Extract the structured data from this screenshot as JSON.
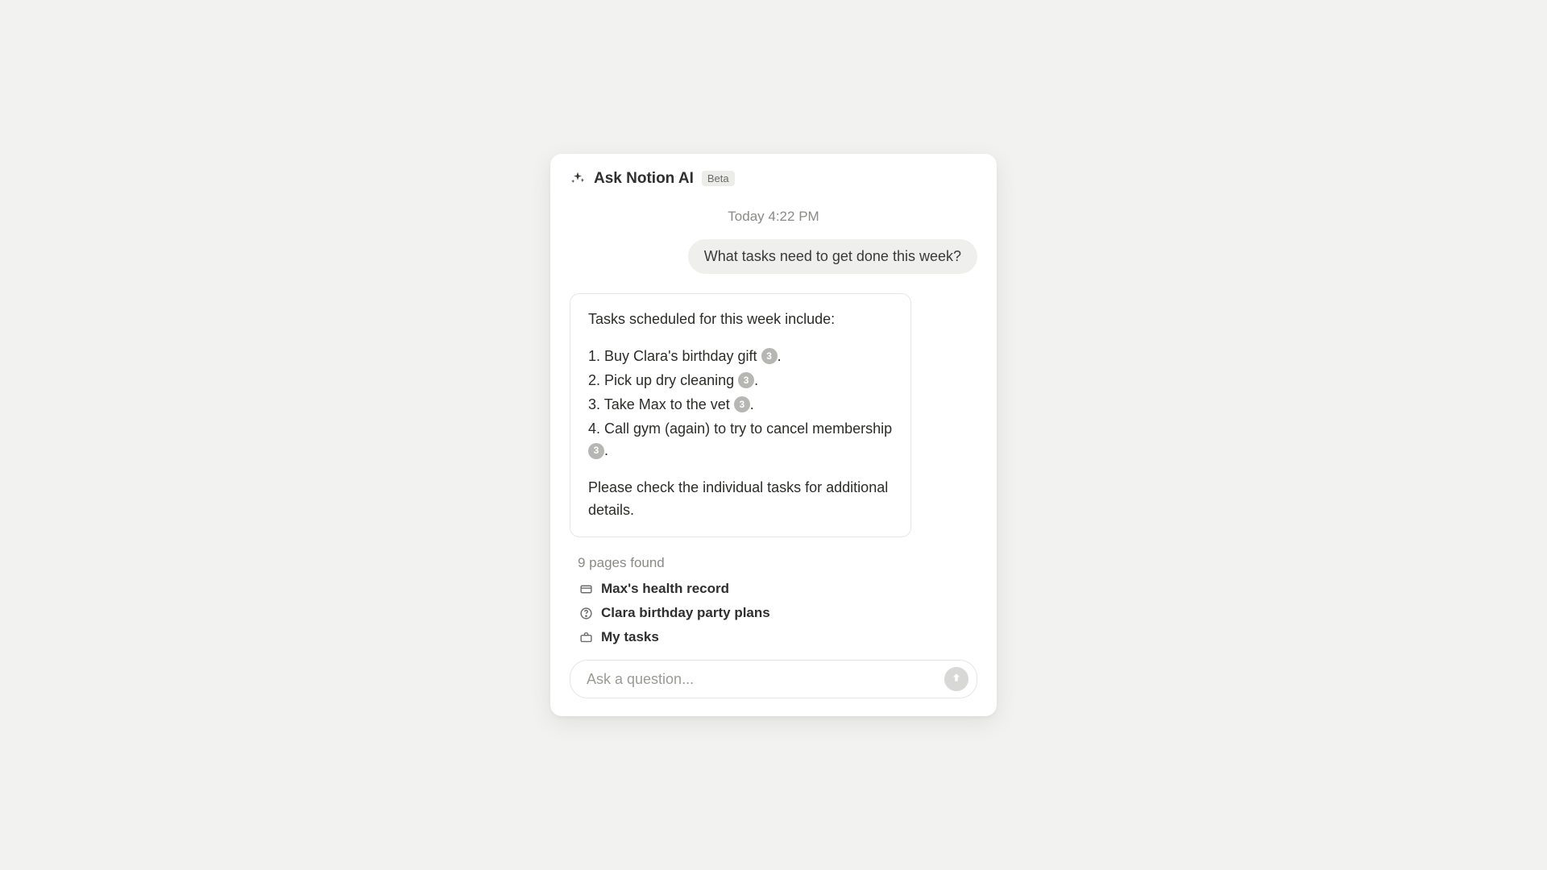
{
  "header": {
    "title": "Ask Notion AI",
    "badge": "Beta"
  },
  "timestamp": "Today 4:22 PM",
  "user_message": "What tasks need to get done this week?",
  "ai_response": {
    "lead": "Tasks scheduled for this week include:",
    "tasks": [
      {
        "n": "1",
        "text": "Buy Clara's birthday gift",
        "ref": "3"
      },
      {
        "n": "2",
        "text": "Pick up dry cleaning",
        "ref": "3"
      },
      {
        "n": "3",
        "text": "Take Max to the vet",
        "ref": "3"
      },
      {
        "n": "4",
        "text": "Call gym (again) to try to cancel membership",
        "ref": "3"
      }
    ],
    "closing": "Please check the individual tasks for additional details."
  },
  "pages_found_label": "9 pages found",
  "pages": [
    {
      "icon": "card",
      "title": "Max's health record"
    },
    {
      "icon": "help",
      "title": "Clara birthday party plans"
    },
    {
      "icon": "briefcase",
      "title": "My tasks"
    }
  ],
  "input": {
    "placeholder": "Ask a question..."
  }
}
